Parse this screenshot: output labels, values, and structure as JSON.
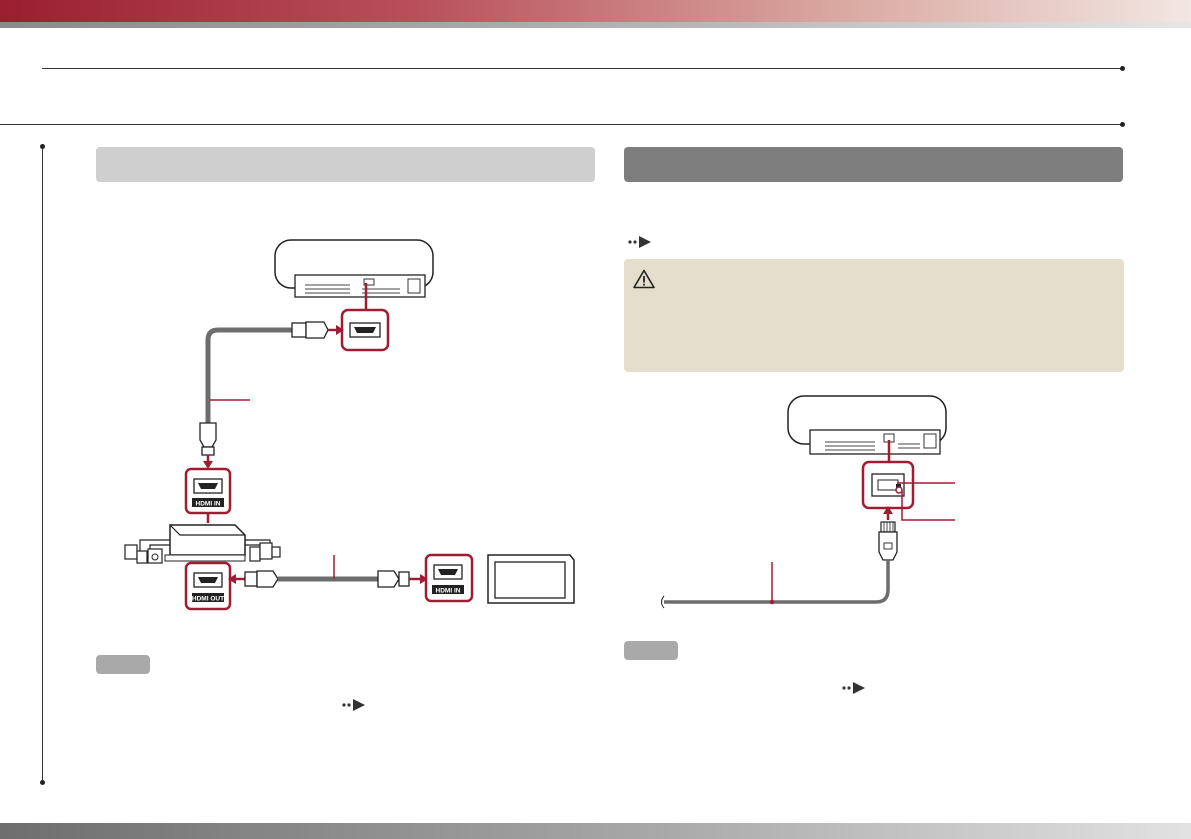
{
  "sections": {
    "left": {
      "header": "",
      "notes_tag": ""
    },
    "right": {
      "header": "",
      "notes_tag": ""
    }
  },
  "ports": {
    "hdmi_in": "HDMI IN",
    "hdmi_out": "HDMI OUT"
  },
  "icons": {
    "reference": "reference-arrow-icon",
    "caution": "caution-triangle-icon"
  },
  "colors": {
    "accent": "#a01c32",
    "cable": "#6d6d6d",
    "header_light": "#cfcfcf",
    "header_dark": "#7e7e7e",
    "caution_bg": "#e6decc"
  }
}
